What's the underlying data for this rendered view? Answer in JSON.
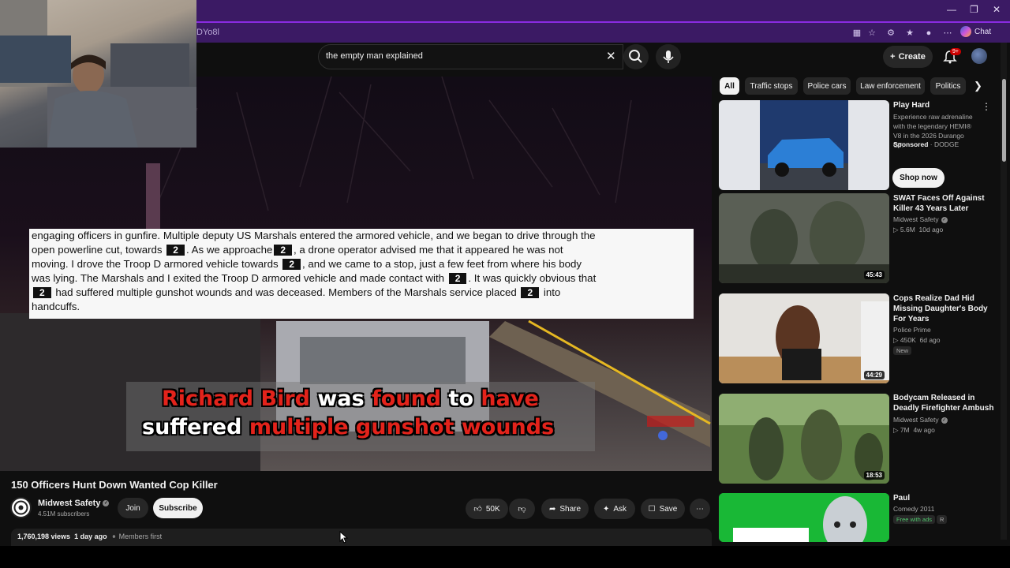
{
  "browser": {
    "url_fragment": "DYo8l",
    "chat_label": "Chat",
    "window_controls": [
      "minimize",
      "restore",
      "close"
    ]
  },
  "header": {
    "search_query": "the empty man explained",
    "create_label": "Create",
    "notification_badge": "9+"
  },
  "video": {
    "document_lines": [
      {
        "parts": [
          {
            "t": "engaging officers in gunfire. Multiple deputy US Marshals entered the armored vehicle, and we began to drive through the"
          }
        ]
      },
      {
        "parts": [
          {
            "t": "open powerline cut, towards "
          },
          {
            "r": "2"
          },
          {
            "t": ". As we approache"
          },
          {
            "r": "2"
          },
          {
            "t": ", a drone operator advised me that it appeared he was not"
          }
        ]
      },
      {
        "parts": [
          {
            "t": "moving. I drove the Troop D armored vehicle towards "
          },
          {
            "r": "2"
          },
          {
            "t": ", and we came to a stop, just a few feet from where his body"
          }
        ]
      },
      {
        "parts": [
          {
            "t": "was lying. The Marshals and I exited the Troop D armored vehicle and made contact with "
          },
          {
            "r": "2"
          },
          {
            "t": ". It was quickly obvious that"
          }
        ]
      },
      {
        "parts": [
          {
            "r": "2"
          },
          {
            "t": " had suffered multiple gunshot wounds and was deceased. Members of the Marshals service placed "
          },
          {
            "r": "2"
          },
          {
            "t": " into"
          }
        ]
      },
      {
        "parts": [
          {
            "t": "handcuffs."
          }
        ]
      }
    ],
    "caption_line1": [
      {
        "text": "Richard Bird",
        "color": "red"
      },
      {
        "text": " was ",
        "color": "white"
      },
      {
        "text": "found",
        "color": "red"
      },
      {
        "text": " to ",
        "color": "white"
      },
      {
        "text": "have",
        "color": "red"
      }
    ],
    "caption_line2": [
      {
        "text": "suffered ",
        "color": "white"
      },
      {
        "text": "multiple gunshot wounds",
        "color": "red"
      }
    ],
    "title": "150 Officers Hunt Down Wanted Cop Killer",
    "channel": "Midwest Safety",
    "subscribers": "4.51M subscribers",
    "join_label": "Join",
    "subscribe_label": "Subscribe",
    "likes": "50K",
    "share_label": "Share",
    "ask_label": "Ask",
    "save_label": "Save",
    "views": "1,760,198 views",
    "age": "1 day ago",
    "members": "Members first"
  },
  "chips": [
    "All",
    "Traffic stops",
    "Police cars",
    "Law enforcement",
    "Politics"
  ],
  "ad": {
    "title": "Play Hard",
    "description": "Experience raw adrenaline with the legendary HEMI® V8 in the 2026 Durango GT.",
    "sponsored": "Sponsored",
    "advertiser": "DODGE",
    "cta": "Shop now"
  },
  "recommendations": [
    {
      "title": "SWAT Faces Off Against Killer 43 Years Later",
      "channel": "Midwest Safety",
      "verified": true,
      "views": "5.6M",
      "age": "10d ago",
      "duration": "45:43",
      "badge": ""
    },
    {
      "title": "Cops Realize Dad Hid Missing Daughter's Body For Years",
      "channel": "Police Prime",
      "verified": false,
      "views": "450K",
      "age": "6d ago",
      "duration": "44:29",
      "badge": "New"
    },
    {
      "title": "Bodycam Released in Deadly Firefighter Ambush",
      "channel": "Midwest Safety",
      "verified": true,
      "views": "7M",
      "age": "4w ago",
      "duration": "18:53",
      "badge": ""
    },
    {
      "title": "Paul",
      "channel": "Comedy 2011",
      "verified": false,
      "views": "",
      "age": "",
      "duration": "",
      "badge": "Free with ads",
      "rating": "R"
    }
  ],
  "colors": {
    "chrome_purple": "#3b1a64",
    "accent_purple": "#8a2be2",
    "caption_red": "#e3231b",
    "yt_bg": "#0f0f0f",
    "notif_red": "#cc0000"
  }
}
